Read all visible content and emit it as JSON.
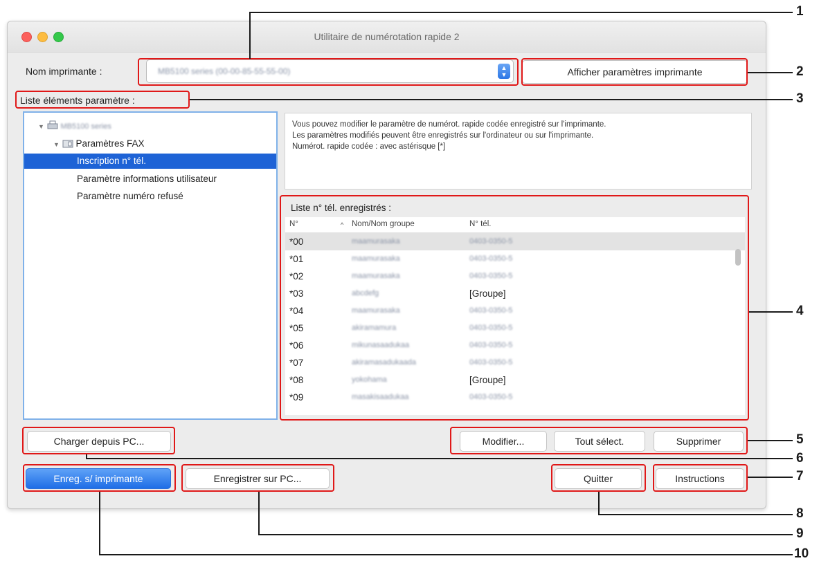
{
  "window": {
    "title": "Utilitaire de numérotation rapide 2"
  },
  "printer": {
    "label": "Nom imprimante :",
    "value": "MB5100 series (00-00-85-55-55-00)",
    "show_settings_button": "Afficher paramètres imprimante"
  },
  "settings_list_label": "Liste éléments paramètre :",
  "tree": {
    "root": "MB5100 series",
    "fax": "Paramètres FAX",
    "items": [
      "Inscription n° tél.",
      "Paramètre informations utilisateur",
      "Paramètre numéro refusé"
    ]
  },
  "description": [
    "Vous pouvez modifier le paramètre de numérot. rapide codée enregistré sur l'imprimante.",
    "Les paramètres modifiés peuvent être enregistrés sur l'ordinateur ou sur l'imprimante.",
    "Numérot. rapide codée : avec astérisque [*]"
  ],
  "registered_list": {
    "title": "Liste n° tél. enregistrés :",
    "columns": [
      "N°",
      "Nom/Nom groupe",
      "N° tél."
    ],
    "rows": [
      {
        "no": "*00",
        "name": "maamurasaka",
        "tel": "0403-0350-5"
      },
      {
        "no": "*01",
        "name": "maamurasaka",
        "tel": "0403-0350-5"
      },
      {
        "no": "*02",
        "name": "maamurasaka",
        "tel": "0403-0350-5"
      },
      {
        "no": "*03",
        "name": "abcdefg",
        "tel": "[Groupe]"
      },
      {
        "no": "*04",
        "name": "maamurasaka",
        "tel": "0403-0350-5"
      },
      {
        "no": "*05",
        "name": "akiramamura",
        "tel": "0403-0350-5"
      },
      {
        "no": "*06",
        "name": "mikunasaadukaa",
        "tel": "0403-0350-5"
      },
      {
        "no": "*07",
        "name": "akiramasadukaada",
        "tel": "0403-0350-5"
      },
      {
        "no": "*08",
        "name": "yokohama",
        "tel": "[Groupe]"
      },
      {
        "no": "*09",
        "name": "masakisaadukaa",
        "tel": "0403-0350-5"
      }
    ]
  },
  "buttons": {
    "load_from_pc": "Charger depuis PC...",
    "modify": "Modifier...",
    "select_all": "Tout sélect.",
    "delete": "Supprimer",
    "save_to_printer": "Enreg. s/ imprimante",
    "save_to_pc": "Enregistrer sur PC...",
    "quit": "Quitter",
    "instructions": "Instructions"
  },
  "callouts": [
    "1",
    "2",
    "3",
    "4",
    "5",
    "6",
    "7",
    "8",
    "9",
    "10"
  ],
  "colors": {
    "callout": "#e01818",
    "selection": "#1e63d6",
    "primary_button": "#2a70dc"
  }
}
